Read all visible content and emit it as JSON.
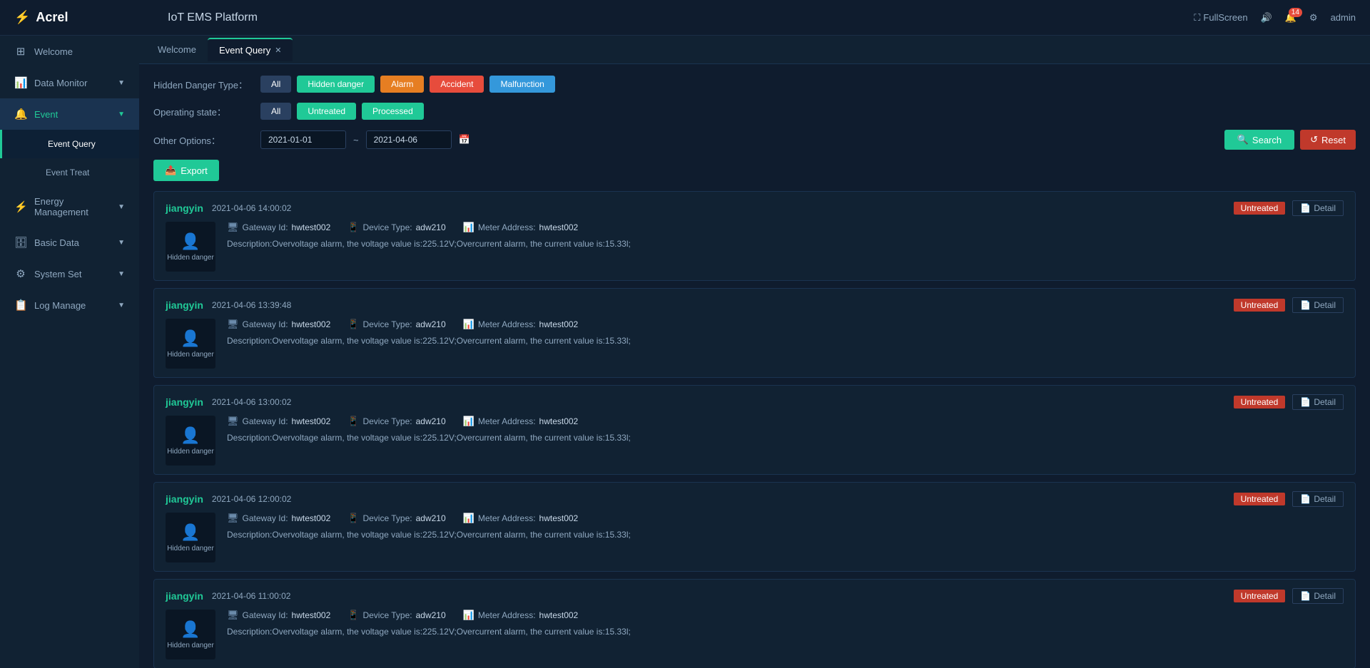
{
  "app": {
    "title": "IoT EMS Platform",
    "logo_icon": "⚡",
    "logo_text": "Acrel"
  },
  "topbar": {
    "fullscreen_label": "FullScreen",
    "notification_count": "14",
    "user_label": "admin"
  },
  "tabs": [
    {
      "id": "welcome",
      "label": "Welcome",
      "closable": false,
      "active": false
    },
    {
      "id": "event-query",
      "label": "Event Query",
      "closable": true,
      "active": true
    }
  ],
  "sidebar": {
    "items": [
      {
        "id": "welcome",
        "label": "Welcome",
        "icon": "⊞",
        "active": false,
        "level": 0
      },
      {
        "id": "data-monitor",
        "label": "Data Monitor",
        "icon": "📊",
        "active": false,
        "level": 0,
        "has_arrow": true
      },
      {
        "id": "event",
        "label": "Event",
        "icon": "🔔",
        "active": true,
        "level": 0,
        "has_arrow": true
      },
      {
        "id": "event-query",
        "label": "Event Query",
        "icon": "",
        "active": true,
        "level": 1
      },
      {
        "id": "event-treat",
        "label": "Event Treat",
        "icon": "",
        "active": false,
        "level": 1
      },
      {
        "id": "energy-management",
        "label": "Energy Management",
        "icon": "⚡",
        "active": false,
        "level": 0,
        "has_arrow": true
      },
      {
        "id": "basic-data",
        "label": "Basic Data",
        "icon": "🗄",
        "active": false,
        "level": 0,
        "has_arrow": true
      },
      {
        "id": "system-set",
        "label": "System Set",
        "icon": "⚙",
        "active": false,
        "level": 0,
        "has_arrow": true
      },
      {
        "id": "log-manage",
        "label": "Log Manage",
        "icon": "📋",
        "active": false,
        "level": 0,
        "has_arrow": true
      }
    ]
  },
  "filters": {
    "hidden_danger_type_label": "Hidden Danger Type：",
    "operating_state_label": "Operating state：",
    "other_options_label": "Other Options：",
    "type_buttons": [
      {
        "id": "all",
        "label": "All",
        "active_class": "active-all"
      },
      {
        "id": "hidden-danger",
        "label": "Hidden danger",
        "active_class": "active-green"
      },
      {
        "id": "alarm",
        "label": "Alarm",
        "active_class": "active-orange"
      },
      {
        "id": "accident",
        "label": "Accident",
        "active_class": "active-red"
      },
      {
        "id": "malfunction",
        "label": "Malfunction",
        "active_class": "active-blue"
      }
    ],
    "state_buttons": [
      {
        "id": "all",
        "label": "All",
        "active_class": "active-all"
      },
      {
        "id": "untreated",
        "label": "Untreated",
        "active_class": "active-green"
      },
      {
        "id": "processed",
        "label": "Processed",
        "active_class": "active-green"
      }
    ],
    "date_from": "2021-01-01",
    "date_to": "2021-04-06",
    "date_separator": "~",
    "search_label": "Search",
    "reset_label": "Reset"
  },
  "export_label": "Export",
  "events": [
    {
      "name": "jiangyin",
      "time": "2021-04-06 14:00:02",
      "status": "Untreated",
      "category": "Hidden danger",
      "gateway_id": "hwtest002",
      "device_type": "adw210",
      "meter_address": "hwtest002",
      "description": "Description:Overvoltage alarm, the voltage value is:225.12V;Overcurrent alarm, the current value is:15.33l;"
    },
    {
      "name": "jiangyin",
      "time": "2021-04-06 13:39:48",
      "status": "Untreated",
      "category": "Hidden danger",
      "gateway_id": "hwtest002",
      "device_type": "adw210",
      "meter_address": "hwtest002",
      "description": "Description:Overvoltage alarm, the voltage value is:225.12V;Overcurrent alarm, the current value is:15.33l;"
    },
    {
      "name": "jiangyin",
      "time": "2021-04-06 13:00:02",
      "status": "Untreated",
      "category": "Hidden danger",
      "gateway_id": "hwtest002",
      "device_type": "adw210",
      "meter_address": "hwtest002",
      "description": "Description:Overvoltage alarm, the voltage value is:225.12V;Overcurrent alarm, the current value is:15.33l;"
    },
    {
      "name": "jiangyin",
      "time": "2021-04-06 12:00:02",
      "status": "Untreated",
      "category": "Hidden danger",
      "gateway_id": "hwtest002",
      "device_type": "adw210",
      "meter_address": "hwtest002",
      "description": "Description:Overvoltage alarm, the voltage value is:225.12V;Overcurrent alarm, the current value is:15.33l;"
    },
    {
      "name": "jiangyin",
      "time": "2021-04-06 11:00:02",
      "status": "Untreated",
      "category": "Hidden danger",
      "gateway_id": "hwtest002",
      "device_type": "adw210",
      "meter_address": "hwtest002",
      "description": "Description:Overvoltage alarm, the voltage value is:225.12V;Overcurrent alarm, the current value is:15.33l;"
    }
  ],
  "meta_labels": {
    "gateway_id": "Gateway Id:",
    "device_type": "Device Type:",
    "meter_address": "Meter Address:",
    "detail": "Detail"
  }
}
